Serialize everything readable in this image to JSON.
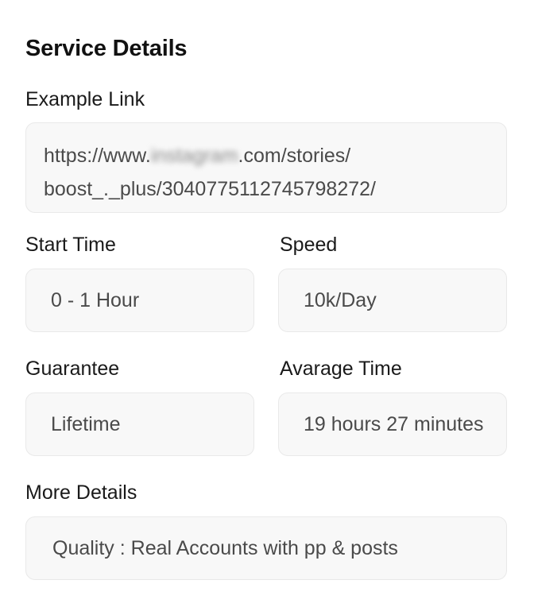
{
  "section_title": "Service Details",
  "example_link": {
    "label": "Example Link",
    "line1_prefix": "https://www.",
    "line1_blurred": "instagram",
    "line1_suffix": ".com/stories/",
    "line2": "boost_._plus/3040775112745798272/"
  },
  "start_time": {
    "label": "Start Time",
    "value": "0 - 1 Hour"
  },
  "speed": {
    "label": "Speed",
    "value": "10k/Day"
  },
  "guarantee": {
    "label": "Guarantee",
    "value": "Lifetime"
  },
  "average_time": {
    "label": "Avarage Time",
    "value": "19 hours 27 minutes"
  },
  "more_details": {
    "label": "More Details",
    "value": "Quality : Real Accounts with pp & posts"
  }
}
